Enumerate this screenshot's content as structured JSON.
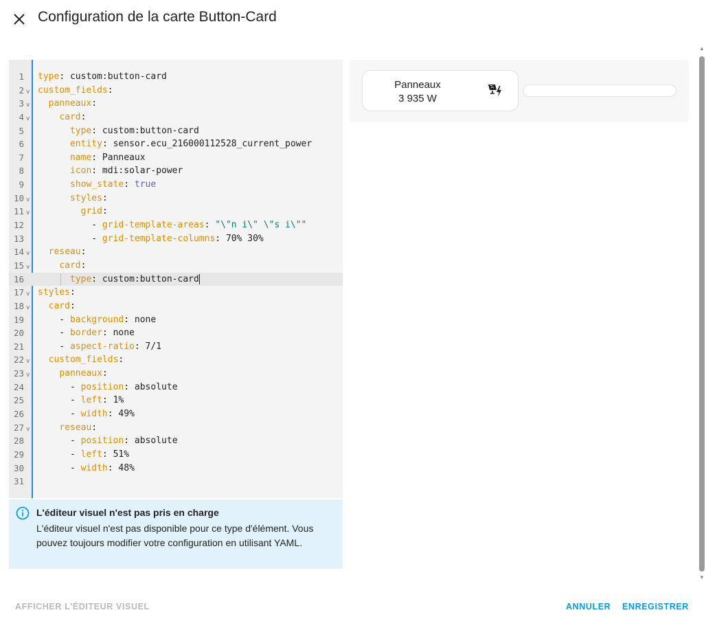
{
  "dialog": {
    "title": "Configuration de la carte Button-Card"
  },
  "editor": {
    "lines": [
      {
        "n": "1",
        "fold": "",
        "html": "<span class=\"k\">type</span>: custom:button-card"
      },
      {
        "n": "2",
        "fold": "v",
        "html": "<span class=\"k\">custom_fields</span>:"
      },
      {
        "n": "3",
        "fold": "v",
        "html": "  <span class=\"k\">panneaux</span>:"
      },
      {
        "n": "4",
        "fold": "v",
        "html": "    <span class=\"k\">card</span>:"
      },
      {
        "n": "5",
        "fold": "",
        "html": "      <span class=\"k\">type</span>: custom:button-card"
      },
      {
        "n": "6",
        "fold": "",
        "html": "      <span class=\"k\">entity</span>: sensor.ecu_216000112528_current_power"
      },
      {
        "n": "7",
        "fold": "",
        "html": "      <span class=\"k\">name</span>: Panneaux"
      },
      {
        "n": "8",
        "fold": "",
        "html": "      <span class=\"k\">icon</span>: mdi:solar-power"
      },
      {
        "n": "9",
        "fold": "",
        "html": "      <span class=\"k\">show_state</span>: <span class=\"b\">true</span>"
      },
      {
        "n": "10",
        "fold": "v",
        "html": "      <span class=\"k\">styles</span>:"
      },
      {
        "n": "11",
        "fold": "v",
        "html": "        <span class=\"k\">grid</span>:"
      },
      {
        "n": "12",
        "fold": "",
        "html": "          - <span class=\"k\">grid-template-areas</span>: <span class=\"s\">\"\\\"n i\\\" \\\"s i\\\"\"</span>"
      },
      {
        "n": "13",
        "fold": "",
        "html": "          - <span class=\"k\">grid-template-columns</span>: 70% 30%"
      },
      {
        "n": "14",
        "fold": "v",
        "html": "  <span class=\"k\">reseau</span>:"
      },
      {
        "n": "15",
        "fold": "v",
        "html": "    <span class=\"k\">card</span>:"
      },
      {
        "n": "16",
        "fold": "",
        "html": "      <span class=\"k\">type</span>: custom:button-card<span class=\"cursor\"></span>"
      },
      {
        "n": "17",
        "fold": "v",
        "html": "<span class=\"k\">styles</span>:"
      },
      {
        "n": "18",
        "fold": "v",
        "html": "  <span class=\"k\">card</span>:"
      },
      {
        "n": "19",
        "fold": "",
        "html": "    - <span class=\"k\">background</span>: none"
      },
      {
        "n": "20",
        "fold": "",
        "html": "    - <span class=\"k\">border</span>: none"
      },
      {
        "n": "21",
        "fold": "",
        "html": "    - <span class=\"k\">aspect-ratio</span>: 7/1"
      },
      {
        "n": "22",
        "fold": "v",
        "html": "  <span class=\"k\">custom_fields</span>:"
      },
      {
        "n": "23",
        "fold": "v",
        "html": "    <span class=\"k\">panneaux</span>:"
      },
      {
        "n": "24",
        "fold": "",
        "html": "      - <span class=\"k\">position</span>: absolute"
      },
      {
        "n": "25",
        "fold": "",
        "html": "      - <span class=\"k\">left</span>: 1%"
      },
      {
        "n": "26",
        "fold": "",
        "html": "      - <span class=\"k\">width</span>: 49%"
      },
      {
        "n": "27",
        "fold": "v",
        "html": "    <span class=\"k\">reseau</span>:"
      },
      {
        "n": "28",
        "fold": "",
        "html": "      - <span class=\"k\">position</span>: absolute"
      },
      {
        "n": "29",
        "fold": "",
        "html": "      - <span class=\"k\">left</span>: 51%"
      },
      {
        "n": "30",
        "fold": "",
        "html": "      - <span class=\"k\">width</span>: 48%"
      },
      {
        "n": "31",
        "fold": "",
        "html": ""
      }
    ],
    "active_line": "16"
  },
  "alert": {
    "title": "L'éditeur visuel n'est pas pris en charge",
    "body": "L'éditeur visuel n'est pas disponible pour ce type d'élément. Vous pouvez toujours modifier votre configuration en utilisant YAML."
  },
  "preview": {
    "card_name": "Panneaux",
    "card_state": "3 935 W",
    "card_icon": "solar-power-icon"
  },
  "footer": {
    "show_visual_label": "AFFICHER L'ÉDITEUR VISUEL",
    "cancel_label": "ANNULER",
    "save_label": "ENREGISTRER"
  },
  "colors": {
    "accent": "#0a9ae0",
    "editor_border": "#1e88e5",
    "yaml_key": "#e08e00",
    "alert_bg": "#e1f2fb"
  }
}
